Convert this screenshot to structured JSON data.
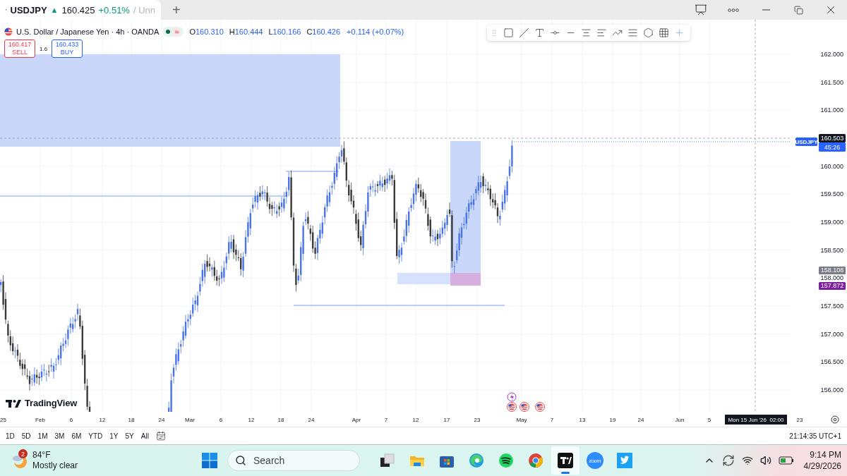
{
  "tab": {
    "symbol": "USDJPY",
    "direction_mark": "▲",
    "price": "160.425",
    "change": "+0.51%",
    "layout_name": "/ Unn",
    "selected": true
  },
  "new_tab_mark": "+",
  "legend": {
    "title": "U.S. Dollar / Japanese Yen · 4h · OANDA",
    "status_mark": "≈",
    "ohlc": [
      {
        "key": "O",
        "value": "160.310"
      },
      {
        "key": "H",
        "value": "160.444"
      },
      {
        "key": "L",
        "value": "160.166"
      },
      {
        "key": "C",
        "value": "160.426"
      }
    ],
    "change": "+0.114 (+0.07%)"
  },
  "trade": {
    "sell": {
      "price": "160.417",
      "label": "SELL"
    },
    "spread": "1.6",
    "buy": {
      "price": "160.433",
      "label": "BUY"
    }
  },
  "price_axis": {
    "labels": [
      "162.000",
      "161.500",
      "161.000",
      "160.000",
      "159.500",
      "159.000",
      "158.500",
      "158.000",
      "157.500",
      "157.000",
      "156.500",
      "156.000"
    ]
  },
  "price_tags": [
    {
      "kind": "symbol",
      "text": "USDJPY",
      "color": "#2962ff"
    },
    {
      "kind": "last",
      "text": "160.503",
      "color": "#131722"
    },
    {
      "kind": "countdown",
      "text": "45:26",
      "color": "#2962ff"
    },
    {
      "kind": "level",
      "text": "158.108",
      "color": "#787b86"
    },
    {
      "kind": "level",
      "text": "157.872",
      "color": "#7b1fa2"
    }
  ],
  "time_axis": {
    "labels": [
      "25",
      "Feb",
      "6",
      "12",
      "18",
      "24",
      "Mar",
      "6",
      "12",
      "18",
      "24",
      "Apr",
      "7",
      "12",
      "17",
      "23",
      "May",
      "7",
      "13",
      "19",
      "24",
      "Jun",
      "5"
    ],
    "crosshair_label": "Mon 15 Jun '26  02:00",
    "last_label": "23"
  },
  "logo": "TradingView",
  "ranges": [
    "1D",
    "5D",
    "1M",
    "3M",
    "6M",
    "YTD",
    "1Y",
    "5Y",
    "All"
  ],
  "clock": "21:14:35 UTC+1",
  "taskbar": {
    "weather": {
      "badge": "2",
      "temperature": "84°F",
      "summary": "Mostly clear"
    },
    "search": {
      "placeholder": "Search"
    },
    "apps": [
      {
        "kind": "task-view",
        "selected": false
      },
      {
        "kind": "folder",
        "selected": false
      },
      {
        "kind": "store",
        "selected": false
      },
      {
        "kind": "edge",
        "selected": false
      },
      {
        "kind": "spotify",
        "selected": false
      },
      {
        "kind": "chrome",
        "selected": false
      },
      {
        "kind": "tradingview",
        "selected": true
      },
      {
        "kind": "zoom",
        "label": "zoom",
        "selected": false
      },
      {
        "kind": "twitter",
        "selected": false
      }
    ],
    "time": "9:14 PM",
    "date": "4/29/2026"
  }
}
